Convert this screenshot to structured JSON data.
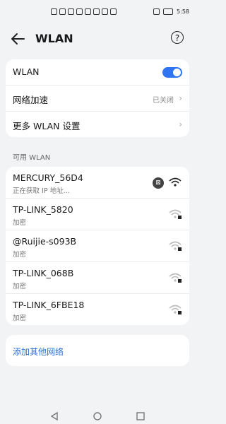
{
  "status_bar": {
    "time": "5:58",
    "left_icons": [
      "signal-icon",
      "signal-icon",
      "data-icon",
      "mail-icon",
      "message-icon",
      "chat-icon",
      "cloud-icon",
      "app-icon"
    ],
    "right_icons": [
      "eye-icon",
      "battery-icon"
    ]
  },
  "header": {
    "title": "WLAN",
    "back_icon": "back-arrow-icon",
    "help_icon": "help-circle-icon"
  },
  "settings": {
    "wlan_label": "WLAN",
    "wlan_enabled": true,
    "accelerate_label": "网络加速",
    "accelerate_value": "已关闭",
    "more_label": "更多 WLAN 设置"
  },
  "available_title": "可用 WLAN",
  "networks": [
    {
      "ssid": "MERCURY_56D4",
      "sub": "正在获取 IP 地址...",
      "locked": false
    },
    {
      "ssid": "TP-LINK_5820",
      "sub": "加密",
      "locked": true
    },
    {
      "ssid": "@Ruijie-s093B",
      "sub": "加密",
      "locked": true
    },
    {
      "ssid": "TP-LINK_068B",
      "sub": "加密",
      "locked": true
    },
    {
      "ssid": "TP-LINK_6FBE18",
      "sub": "加密",
      "locked": true
    }
  ],
  "add_network_label": "添加其他网络",
  "nav_buttons": [
    "back-triangle-icon",
    "home-circle-icon",
    "recents-square-icon"
  ]
}
